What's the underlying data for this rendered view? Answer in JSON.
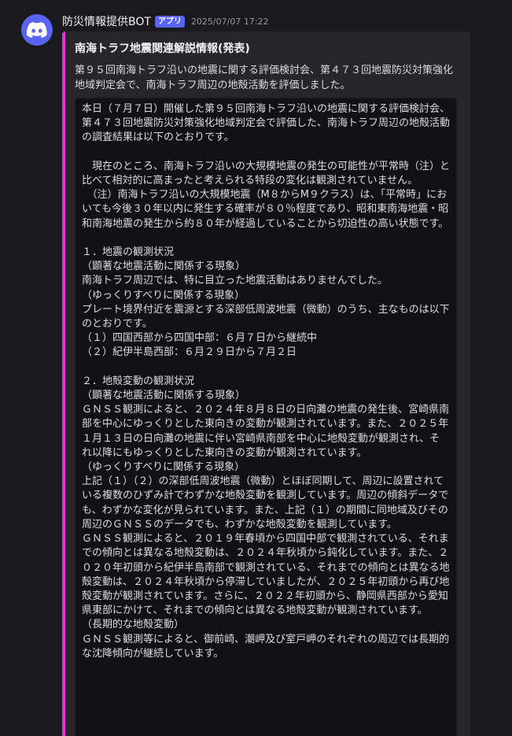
{
  "message": {
    "username": "防災情報提供BOT",
    "bot_tag": "アプリ",
    "timestamp": "2025/07/07 17:22",
    "avatar_icon": "discord-logo-icon",
    "colors": {
      "avatar_bg": "#5865f2",
      "bot_tag_bg": "#5865f2",
      "embed_bar": "#eb2fdc"
    }
  },
  "embed": {
    "title": "南海トラフ地震関連解説情報(発表)",
    "description": "第９５回南海トラフ沿いの地震に関する評価検討会、第４７３回地震防災対策強化地域判定会で、南海トラフ周辺の地殻活動を評価しました。",
    "body": "本日（７月７日）開催した第９５回南海トラフ沿いの地震に関する評価検討会、第４７３回地震防災対策強化地域判定会で評価した、南海トラフ周辺の地殻活動の調査結果は以下のとおりです。\n\n　現在のところ、南海トラフ沿いの大規模地震の発生の可能性が平常時（注）と比べて相対的に高まったと考えられる特段の変化は観測されていません。\n　（注）南海トラフ沿いの大規模地震（M８からM９クラス）は、「平常時」においても今後３０年以内に発生する確率が８０％程度であり、昭和東南海地震・昭和南海地震の発生から約８０年が経過していることから切迫性の高い状態です。\n\n１．地震の観測状況\n（顕著な地震活動に関係する現象）\n南海トラフ周辺では、特に目立った地震活動はありませんでした。\n（ゆっくりすべりに関係する現象）\nプレート境界付近を震源とする深部低周波地震（微動）のうち、主なものは以下のとおりです。\n（１）四国西部から四国中部：６月７日から継続中\n（２）紀伊半島西部：６月２９日から７月２日\n\n２．地殻変動の観測状況\n（顕著な地震活動に関係する現象）\nＧＮＳＳ観測によると、２０２４年８月８日の日向灘の地震の発生後、宮崎県南部を中心にゆっくりとした東向きの変動が観測されています。また、２０２５年１月１３日の日向灘の地震に伴い宮崎県南部を中心に地殻変動が観測され、それ以降にもゆっくりとした東向きの変動が観測されています。\n（ゆっくりすべりに関係する現象）\n上記（１）（２）の深部低周波地震（微動）とほぼ同期して、周辺に設置されている複数のひずみ計でわずかな地殻変動を観測しています。周辺の傾斜データでも、わずかな変化が見られています。また、上記（１）の期間に同地域及びその周辺のＧＮＳＳのデータでも、わずかな地殻変動を観測しています。\nＧＮＳＳ観測によると、２０１９年春頃から四国中部で観測されている、それまでの傾向とは異なる地殻変動は、２０２４年秋頃から鈍化しています。また、２０２０年初頭から紀伊半島南部で観測されている、それまでの傾向とは異なる地殻変動は、２０２４年秋頃から停滞していましたが、２０２５年初頭から再び地殻変動が観測されています。さらに、２０２２年初頭から、静岡県西部から愛知県東部にかけて、それまでの傾向とは異なる地殻変動が観測されています。\n（長期的な地殻変動）\nＧＮＳＳ観測等によると、御前崎、潮岬及び室戸岬のそれぞれの周辺では長期的な沈降傾向が継続しています。"
  }
}
